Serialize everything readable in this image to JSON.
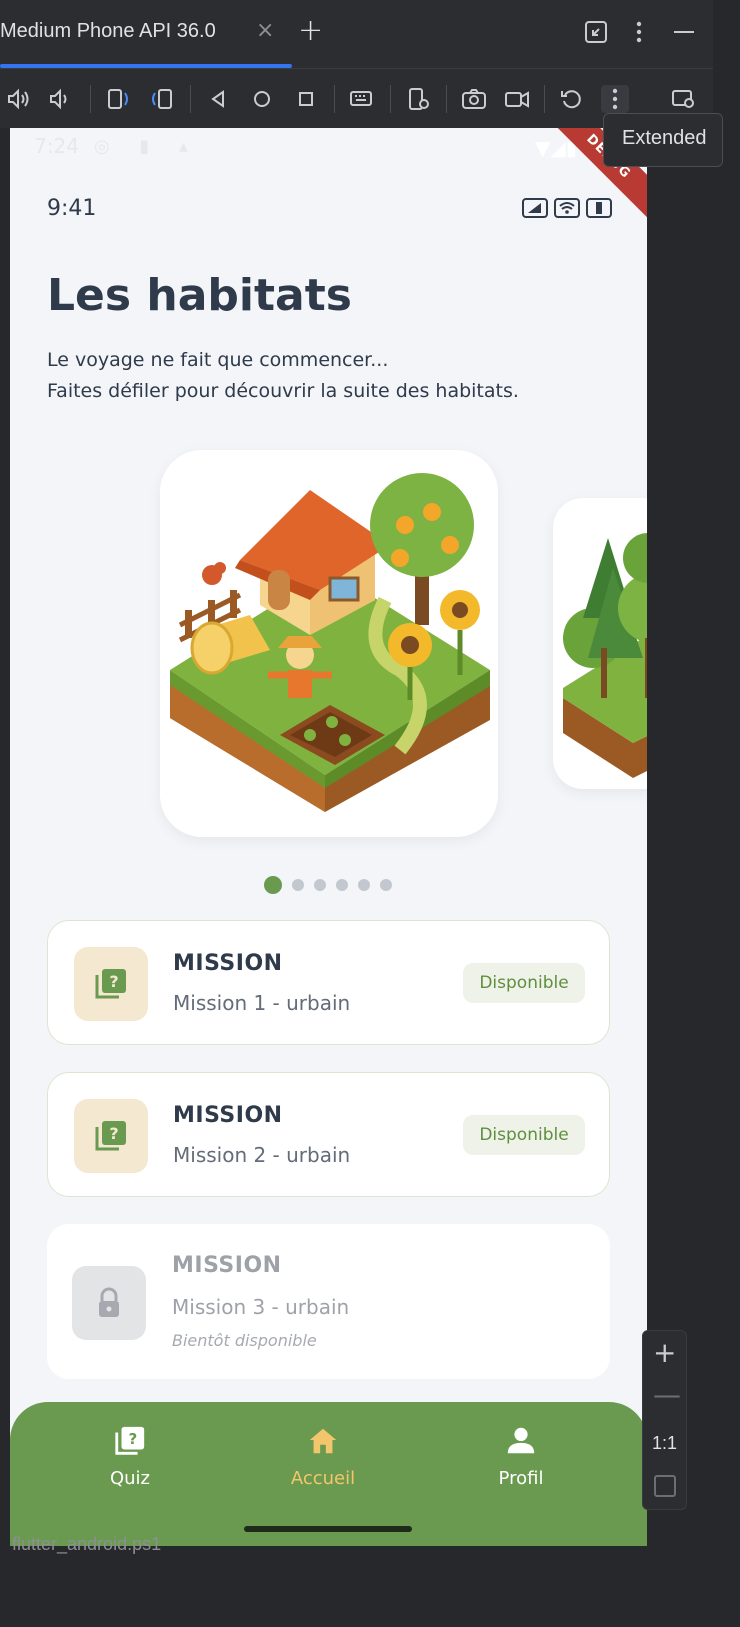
{
  "emulator": {
    "tab_title": "Medium Phone API 36.0",
    "tab_close": "×",
    "tab_add": "+",
    "tooltip": "Extended",
    "zoom": {
      "plus": "+",
      "minus": "—",
      "ratio": "1:1"
    },
    "bottom_strip": "flutter_android.ps1"
  },
  "device_status": {
    "time": "7:24",
    "ribbon": "DEBUG"
  },
  "app": {
    "status_time": "9:41",
    "title": "Les habitats",
    "subtitle_line1": "Le voyage ne fait que commencer...",
    "subtitle_line2": "Faites défiler pour découvrir la suite des habitats.",
    "carousel": {
      "page_count": 6,
      "active_index": 0
    },
    "missions": [
      {
        "title": "MISSION",
        "subtitle": "Mission 1 - urbain",
        "badge": "Disponible",
        "locked": false
      },
      {
        "title": "MISSION",
        "subtitle": "Mission 2 - urbain",
        "badge": "Disponible",
        "locked": false
      },
      {
        "title": "MISSION",
        "subtitle": "Mission 3 - urbain",
        "note": "Bientôt disponible",
        "locked": true
      }
    ],
    "nav": [
      {
        "label": "Quiz",
        "icon": "quiz-icon",
        "active": false
      },
      {
        "label": "Accueil",
        "icon": "home-icon",
        "active": true
      },
      {
        "label": "Profil",
        "icon": "person-icon",
        "active": false
      }
    ]
  },
  "colors": {
    "accent_green": "#6a9a4f",
    "nav_active": "#f2c66d",
    "badge_text": "#5f8f3e",
    "mission_icon_bg": "#f4e8d1"
  }
}
